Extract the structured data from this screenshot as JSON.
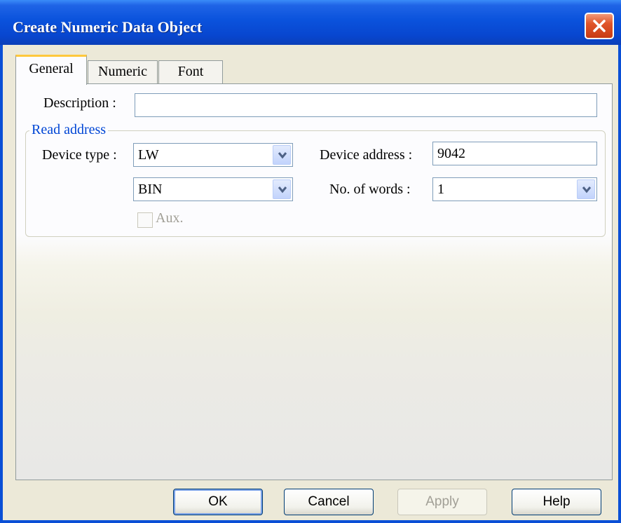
{
  "window": {
    "title": "Create Numeric Data Object"
  },
  "tabs": [
    {
      "label": "General",
      "active": true
    },
    {
      "label": "Numeric",
      "active": false
    },
    {
      "label": "Font",
      "active": false
    }
  ],
  "general": {
    "description_label": "Description :",
    "description_value": "",
    "read_address": {
      "legend": "Read address",
      "device_type_label": "Device type :",
      "device_type_value": "LW",
      "format_value": "BIN",
      "device_address_label": "Device address :",
      "device_address_value": "9042",
      "no_of_words_label": "No. of words :",
      "no_of_words_value": "1",
      "aux_label": "Aux.",
      "aux_checked": false,
      "aux_enabled": false
    }
  },
  "buttons": {
    "ok": "OK",
    "cancel": "Cancel",
    "apply": "Apply",
    "help": "Help",
    "apply_enabled": false
  },
  "colors": {
    "titlebar": "#0a52dc",
    "tab_highlight": "#ffc83c",
    "legend_text": "#0046d5",
    "dialog_bg": "#ece9d8"
  },
  "icons": {
    "close": "close-icon",
    "dropdown": "chevron-down-icon"
  }
}
